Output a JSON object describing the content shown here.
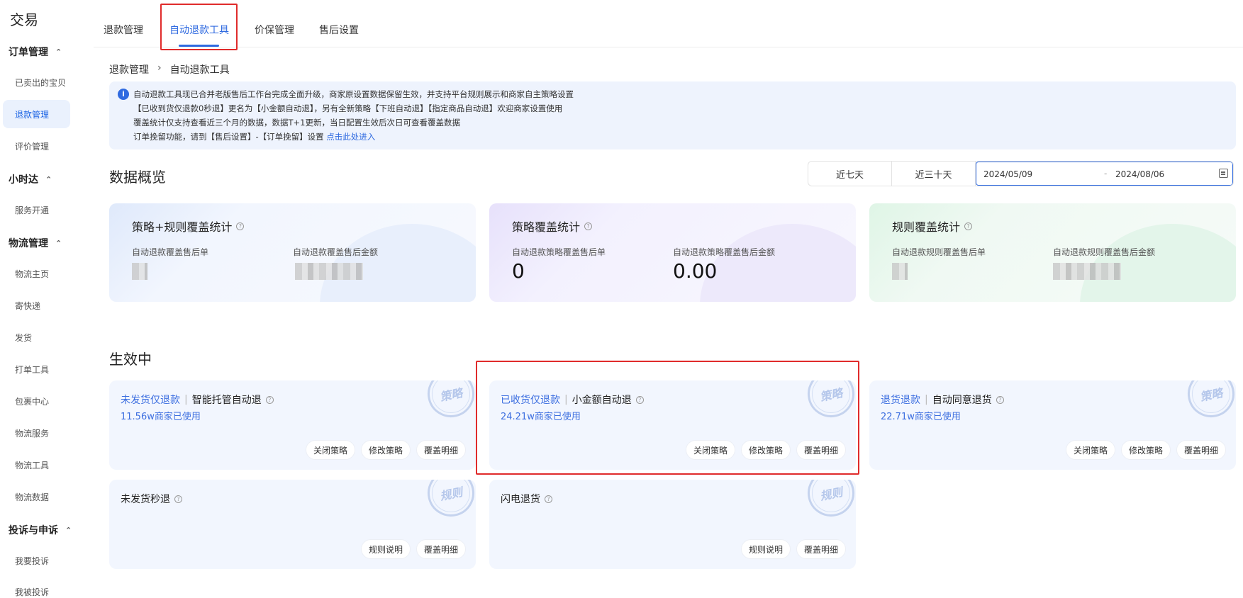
{
  "sidebar": {
    "title": "交易",
    "groups": [
      {
        "label": "订单管理",
        "items": [
          "已卖出的宝贝",
          "退款管理",
          "评价管理"
        ]
      },
      {
        "label": "小时达",
        "items": [
          "服务开通"
        ]
      },
      {
        "label": "物流管理",
        "items": [
          "物流主页",
          "寄快递",
          "发货",
          "打单工具",
          "包裹中心",
          "物流服务",
          "物流工具",
          "物流数据"
        ]
      },
      {
        "label": "投诉与申诉",
        "items": [
          "我要投诉",
          "我被投诉"
        ]
      }
    ],
    "chevron": "⌃"
  },
  "tabs": [
    {
      "label": "退款管理"
    },
    {
      "label": "自动退款工具",
      "active": true
    },
    {
      "label": "价保管理"
    },
    {
      "label": "售后设置"
    }
  ],
  "breadcrumb": {
    "parent": "退款管理",
    "sep": "›",
    "current": "自动退款工具"
  },
  "notice": {
    "icon": "i",
    "line1": "自动退款工具现已合并老版售后工作台完成全面升级，商家原设置数据保留生效，并支持平台规则展示和商家自主策略设置",
    "line2": "【已收到货仅退款0秒退】更名为【小金额自动退】，另有全新策略【下班自动退】【指定商品自动退】欢迎商家设置使用",
    "line3": "覆盖统计仅支持查看近三个月的数据，数据T+1更新，当日配置生效后次日可查看覆盖数据",
    "line4_prefix": "订单挽留功能，请到【售后设置】-【订单挽留】设置 ",
    "line4_link": "点击此处进入"
  },
  "overview": {
    "title": "数据概览",
    "btn_7d": "近七天",
    "btn_30d": "近三十天",
    "date_start": "2024/05/09",
    "date_sep": "-",
    "date_end": "2024/08/06",
    "cards": [
      {
        "title": "策略+规则覆盖统计",
        "label_a": "自动退款覆盖售后单",
        "label_b": "自动退款覆盖售后金额"
      },
      {
        "title": "策略覆盖统计",
        "label_a": "自动退款策略覆盖售后单",
        "value_a": "0",
        "label_b": "自动退款策略覆盖售后金额",
        "value_b": "0.00"
      },
      {
        "title": "规则覆盖统计",
        "label_a": "自动退款规则覆盖售后单",
        "label_b": "自动退款规则覆盖售后金额"
      }
    ]
  },
  "active": {
    "title": "生效中",
    "question": "?",
    "stamp_strategy": "策略",
    "stamp_rule": "规则",
    "btn_close": "关闭策略",
    "btn_edit": "修改策略",
    "btn_detail": "覆盖明细",
    "btn_rule_desc": "规则说明",
    "cards": [
      {
        "type": "未发货仅退款",
        "name": "智能托管自动退",
        "usage": "11.56w商家已使用"
      },
      {
        "type": "已收货仅退款",
        "name": "小金额自动退",
        "usage": "24.21w商家已使用"
      },
      {
        "type": "退货退款",
        "name": "自动同意退货",
        "usage": "22.71w商家已使用"
      },
      {
        "name": "未发货秒退"
      },
      {
        "name": "闪电退货"
      }
    ]
  }
}
